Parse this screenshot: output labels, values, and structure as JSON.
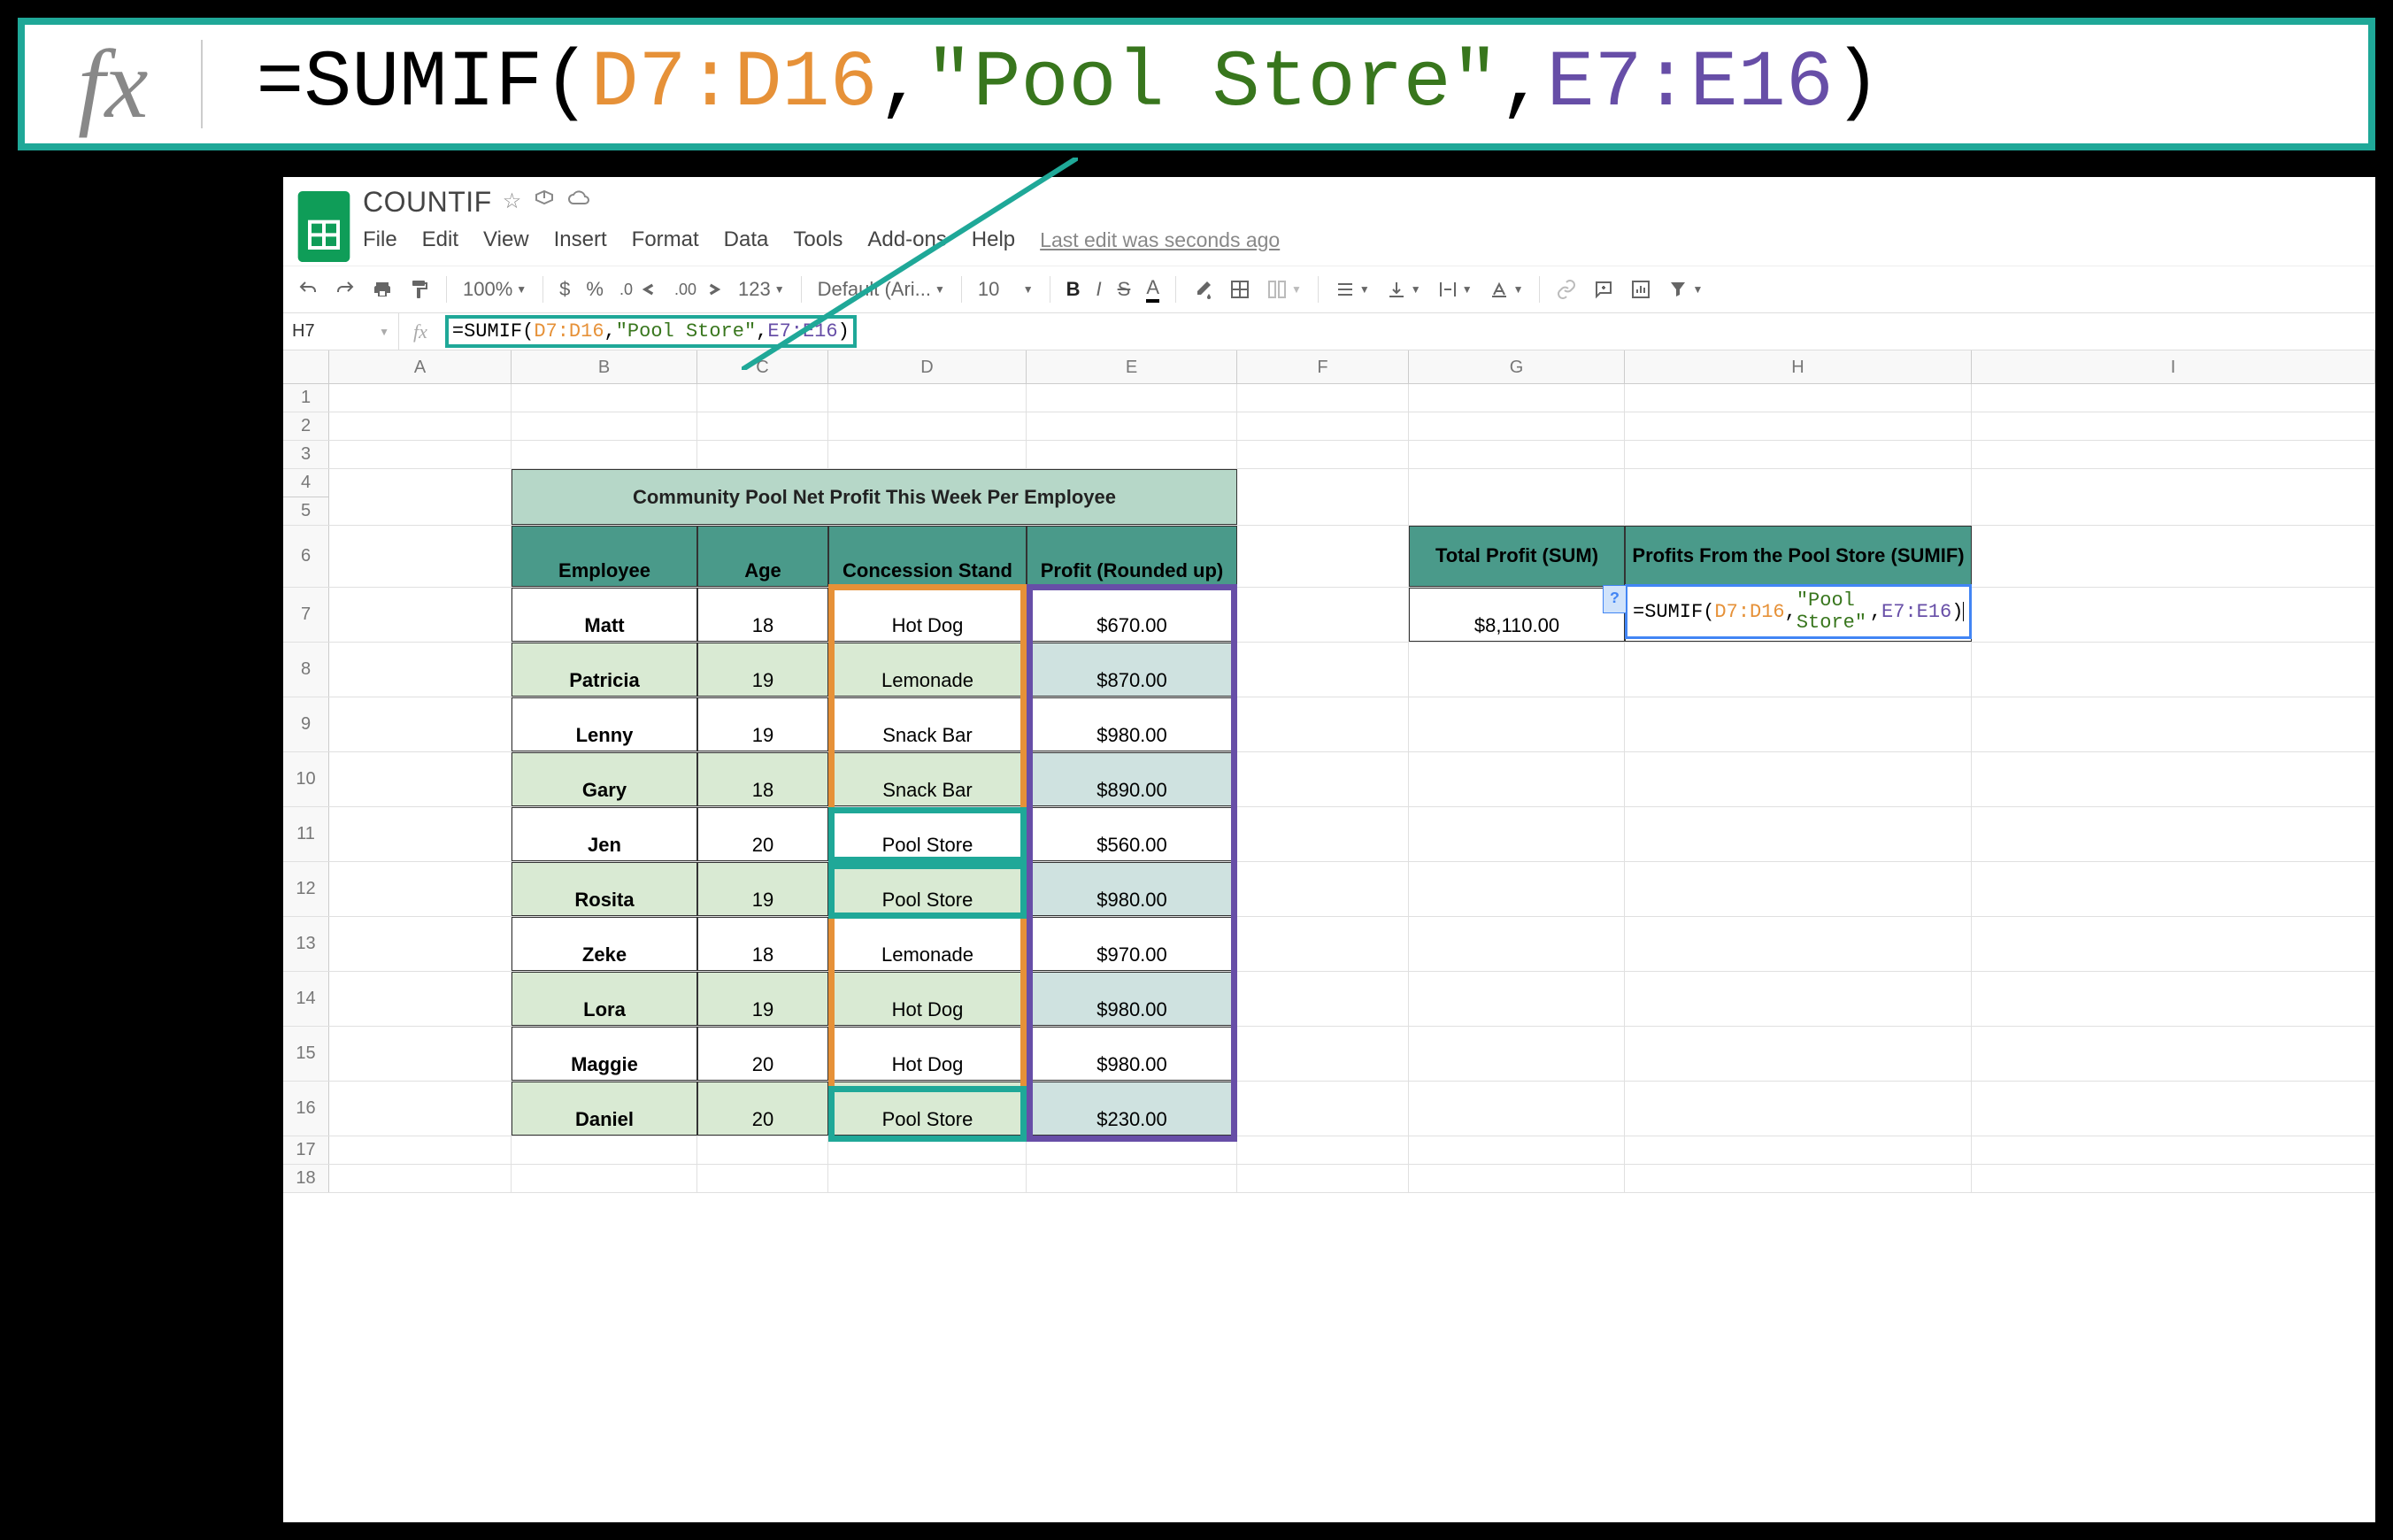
{
  "callout": {
    "formula_prefix": "=SUMIF(",
    "range1": "D7:D16",
    "comma1": ",",
    "criteria": "\"Pool Store\"",
    "comma2": ",",
    "range2": "E7:E16",
    "suffix": ")"
  },
  "doc": {
    "title": "COUNTIF",
    "last_edit": "Last edit was seconds ago"
  },
  "menu": {
    "file": "File",
    "edit": "Edit",
    "view": "View",
    "insert": "Insert",
    "format": "Format",
    "data": "Data",
    "tools": "Tools",
    "addons": "Add-ons",
    "help": "Help"
  },
  "toolbar": {
    "zoom": "100%",
    "currency": "$",
    "percent": "%",
    "dec_dec": ".0",
    "dec_inc": ".00",
    "num_format": "123",
    "font": "Default (Ari...",
    "font_size": "10",
    "bold": "B",
    "italic": "I",
    "strike": "S",
    "text_color": "A"
  },
  "formula_bar": {
    "cell_ref": "H7",
    "prefix": "=SUMIF(",
    "range1": "D7:D16",
    "comma1": ",",
    "criteria": "\"Pool Store\"",
    "comma2": ",",
    "range2": "E7:E16",
    "suffix": ")"
  },
  "columns": [
    "A",
    "B",
    "C",
    "D",
    "E",
    "F",
    "G",
    "H",
    "I"
  ],
  "table": {
    "title": "Community Pool Net Profit This Week Per Employee",
    "headers": {
      "employee": "Employee",
      "age": "Age",
      "stand": "Concession Stand",
      "profit": "Profit (Rounded up)"
    },
    "rows": [
      {
        "employee": "Matt",
        "age": "18",
        "stand": "Hot Dog",
        "profit": "$670.00",
        "alt": false
      },
      {
        "employee": "Patricia",
        "age": "19",
        "stand": "Lemonade",
        "profit": "$870.00",
        "alt": true
      },
      {
        "employee": "Lenny",
        "age": "19",
        "stand": "Snack Bar",
        "profit": "$980.00",
        "alt": false
      },
      {
        "employee": "Gary",
        "age": "18",
        "stand": "Snack Bar",
        "profit": "$890.00",
        "alt": true
      },
      {
        "employee": "Jen",
        "age": "20",
        "stand": "Pool Store",
        "profit": "$560.00",
        "alt": false
      },
      {
        "employee": "Rosita",
        "age": "19",
        "stand": "Pool Store",
        "profit": "$980.00",
        "alt": true
      },
      {
        "employee": "Zeke",
        "age": "18",
        "stand": "Lemonade",
        "profit": "$970.00",
        "alt": false
      },
      {
        "employee": "Lora",
        "age": "19",
        "stand": "Hot Dog",
        "profit": "$980.00",
        "alt": true
      },
      {
        "employee": "Maggie",
        "age": "20",
        "stand": "Hot Dog",
        "profit": "$980.00",
        "alt": false
      },
      {
        "employee": "Daniel",
        "age": "20",
        "stand": "Pool Store",
        "profit": "$230.00",
        "alt": true
      }
    ]
  },
  "summary": {
    "total_profit_header": "Total Profit (SUM)",
    "sumif_header": "Profits From the Pool Store (SUMIF)",
    "total_profit_value": "$8,110.00"
  },
  "editing": {
    "hint": "?",
    "prefix": "=SUMIF(",
    "range1": "D7:D16",
    "comma1": ",",
    "criteria": "\"Pool Store\"",
    "comma2": ",",
    "range2": "E7:E16",
    "suffix": ")"
  },
  "rows_blank": [
    "1",
    "2",
    "3",
    "4",
    "5"
  ],
  "row_nums": [
    "6",
    "7",
    "8",
    "9",
    "10",
    "11",
    "12",
    "13",
    "14",
    "15",
    "16",
    "17",
    "18"
  ]
}
